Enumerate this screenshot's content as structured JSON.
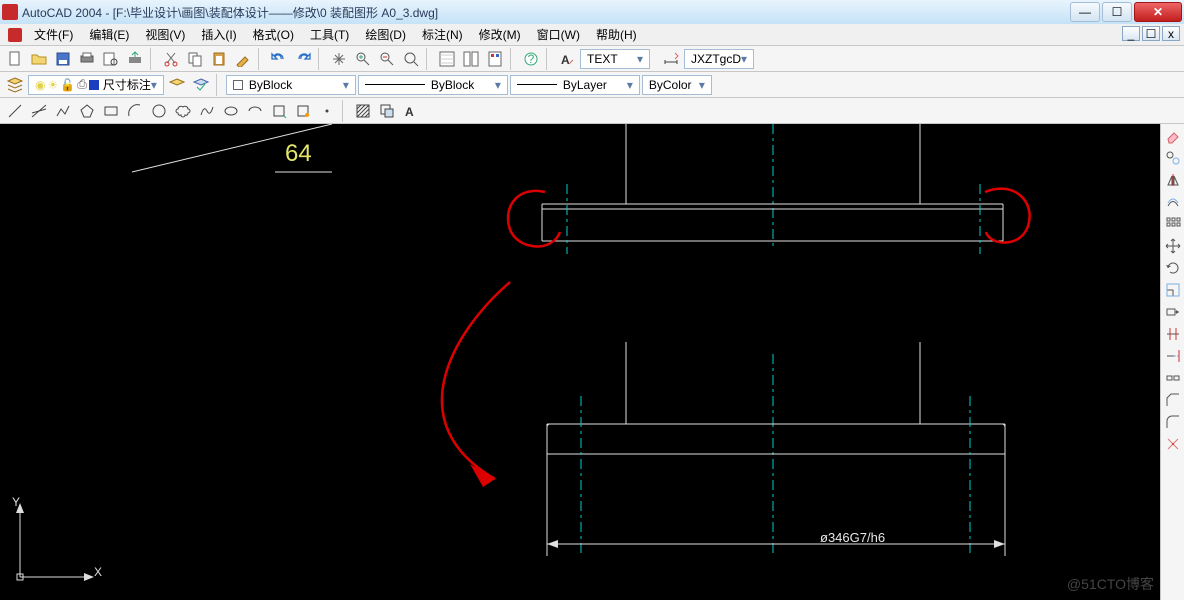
{
  "title": "AutoCAD 2004 - [F:\\毕业设计\\画图\\装配体设计——修改\\0 装配图形 A0_3.dwg]",
  "menu": [
    "文件(F)",
    "编辑(E)",
    "视图(V)",
    "插入(I)",
    "格式(O)",
    "工具(T)",
    "绘图(D)",
    "标注(N)",
    "修改(M)",
    "窗口(W)",
    "帮助(H)"
  ],
  "text_style_combo": "TEXT",
  "dim_style_combo": "JXZTgcD",
  "layer_combo": "尺寸标注",
  "color_combo": "ByBlock",
  "linetype_combo": "ByBlock",
  "lineweight_combo": "ByLayer",
  "plotstyle_combo": "ByColor",
  "dim_value": "64",
  "bottom_dim": "ø346G7/h6",
  "watermark": "@51CTO博客",
  "ucs_labels": {
    "x": "X",
    "y": "Y"
  },
  "win_btns": {
    "min": "—",
    "max": "☐",
    "close": "✕"
  },
  "child_btns": {
    "min": "_",
    "max": "☐",
    "close": "x"
  }
}
